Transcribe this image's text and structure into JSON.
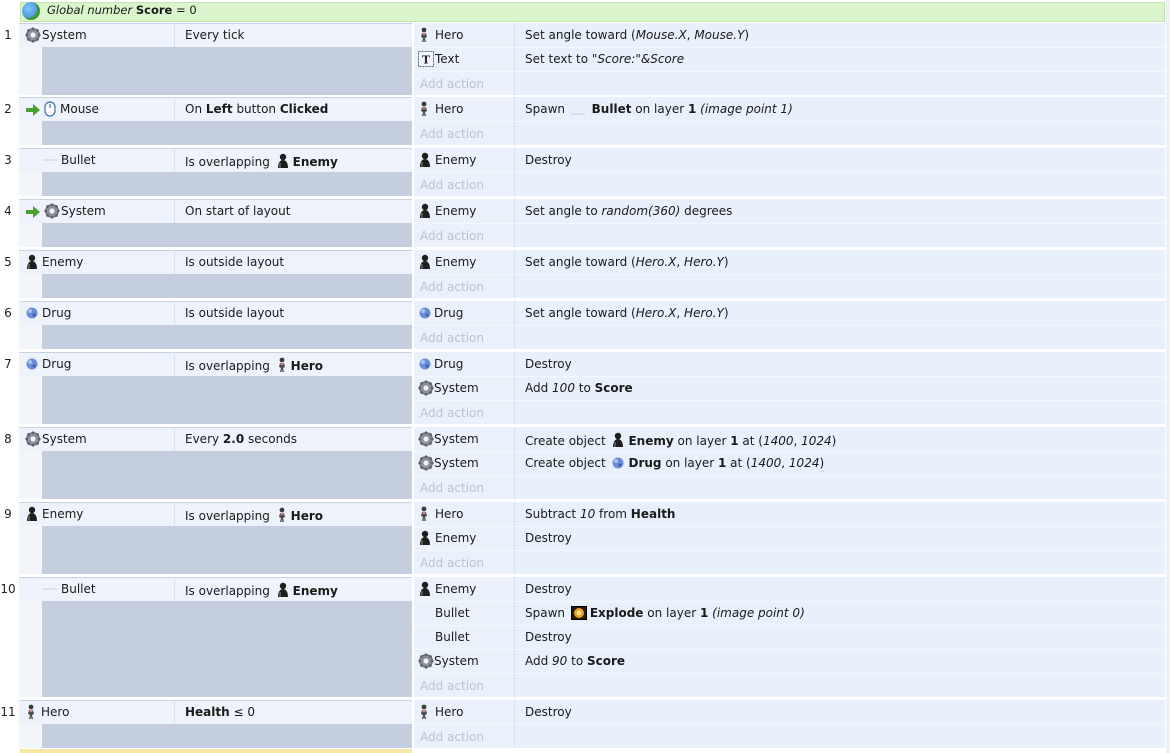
{
  "global_var": {
    "prefix": "Global number",
    "name": "Score",
    "suffix": "= 0"
  },
  "add_action_label": "Add action",
  "events": [
    {
      "num": "1",
      "cond_obj": "System",
      "cond_text": "Every tick",
      "actions": [
        {
          "obj": "Hero",
          "text": "Set angle toward (Mouse.X, Mouse.Y)"
        },
        {
          "obj": "Text",
          "text": "Set text to \"Score:\"&Score"
        }
      ]
    },
    {
      "num": "2",
      "cond_obj": "Mouse",
      "cond_text": "On Left button Clicked",
      "actions": [
        {
          "obj": "Hero",
          "text": "Spawn — Bullet on layer 1 (image point 1)"
        }
      ]
    },
    {
      "num": "3",
      "cond_obj": "Bullet",
      "cond_text": "Is overlapping Enemy",
      "actions": [
        {
          "obj": "Enemy",
          "text": "Destroy"
        }
      ]
    },
    {
      "num": "4",
      "cond_obj": "System",
      "cond_text": "On start of layout",
      "actions": [
        {
          "obj": "Enemy",
          "text": "Set angle to random(360) degrees"
        }
      ]
    },
    {
      "num": "5",
      "cond_obj": "Enemy",
      "cond_text": "Is outside layout",
      "actions": [
        {
          "obj": "Enemy",
          "text": "Set angle toward (Hero.X, Hero.Y)"
        }
      ]
    },
    {
      "num": "6",
      "cond_obj": "Drug",
      "cond_text": "Is outside layout",
      "actions": [
        {
          "obj": "Drug",
          "text": "Set angle toward (Hero.X, Hero.Y)"
        }
      ]
    },
    {
      "num": "7",
      "cond_obj": "Drug",
      "cond_text": "Is overlapping Hero",
      "actions": [
        {
          "obj": "Drug",
          "text": "Destroy"
        },
        {
          "obj": "System",
          "text": "Add 100 to Score"
        }
      ]
    },
    {
      "num": "8",
      "cond_obj": "System",
      "cond_text": "Every 2.0 seconds",
      "actions": [
        {
          "obj": "System",
          "text": "Create object Enemy on layer 1 at (1400, 1024)"
        },
        {
          "obj": "System",
          "text": "Create object Drug on layer 1 at (1400, 1024)"
        }
      ]
    },
    {
      "num": "9",
      "cond_obj": "Enemy",
      "cond_text": "Is overlapping Hero",
      "actions": [
        {
          "obj": "Hero",
          "text": "Subtract 10 from Health"
        },
        {
          "obj": "Enemy",
          "text": "Destroy"
        }
      ]
    },
    {
      "num": "10",
      "cond_obj": "Bullet",
      "cond_text": "Is overlapping Enemy",
      "actions": [
        {
          "obj": "Enemy",
          "text": "Destroy"
        },
        {
          "obj": "Bullet",
          "text": "Spawn Explode on layer 1 (image point 0)"
        },
        {
          "obj": "Bullet",
          "text": "Destroy"
        },
        {
          "obj": "System",
          "text": "Add 90 to Score"
        }
      ]
    },
    {
      "num": "11",
      "cond_obj": "Hero",
      "cond_text": "Health ≤ 0",
      "actions": [
        {
          "obj": "Hero",
          "text": "Destroy"
        }
      ]
    }
  ]
}
